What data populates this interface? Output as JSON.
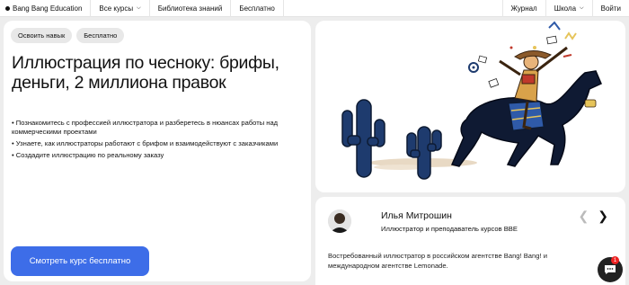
{
  "nav": {
    "brand": "Bang Bang Education",
    "courses": "Все курсы",
    "library": "Библиотека знаний",
    "free": "Бесплатно",
    "journal": "Журнал",
    "school": "Школа",
    "login": "Войти"
  },
  "course": {
    "tags": [
      "Освоить навык",
      "Бесплатно"
    ],
    "title": "Иллюстрация по чесноку: брифы, деньги, 2 миллиона правок",
    "bullets": [
      "Познакомитесь с профессией иллюстратора и разберетесь в нюансах работы над коммерческими проектами",
      "Узнаете, как иллюстраторы работают с брифом и взаимодействуют с заказчиками",
      "Создадите иллюстрацию по реальному заказу"
    ],
    "cta": "Смотреть курс бесплатно"
  },
  "author": {
    "name": "Илья Митрошин",
    "role": "Иллюстратор и преподаватель курсов BBE",
    "description": "Востребованный иллюстратор в российском агентстве Bang! Bang! и международном агентстве Lemonade."
  },
  "chat": {
    "badge": "1"
  },
  "colors": {
    "accent": "#3d6de8",
    "background": "#ededed"
  }
}
